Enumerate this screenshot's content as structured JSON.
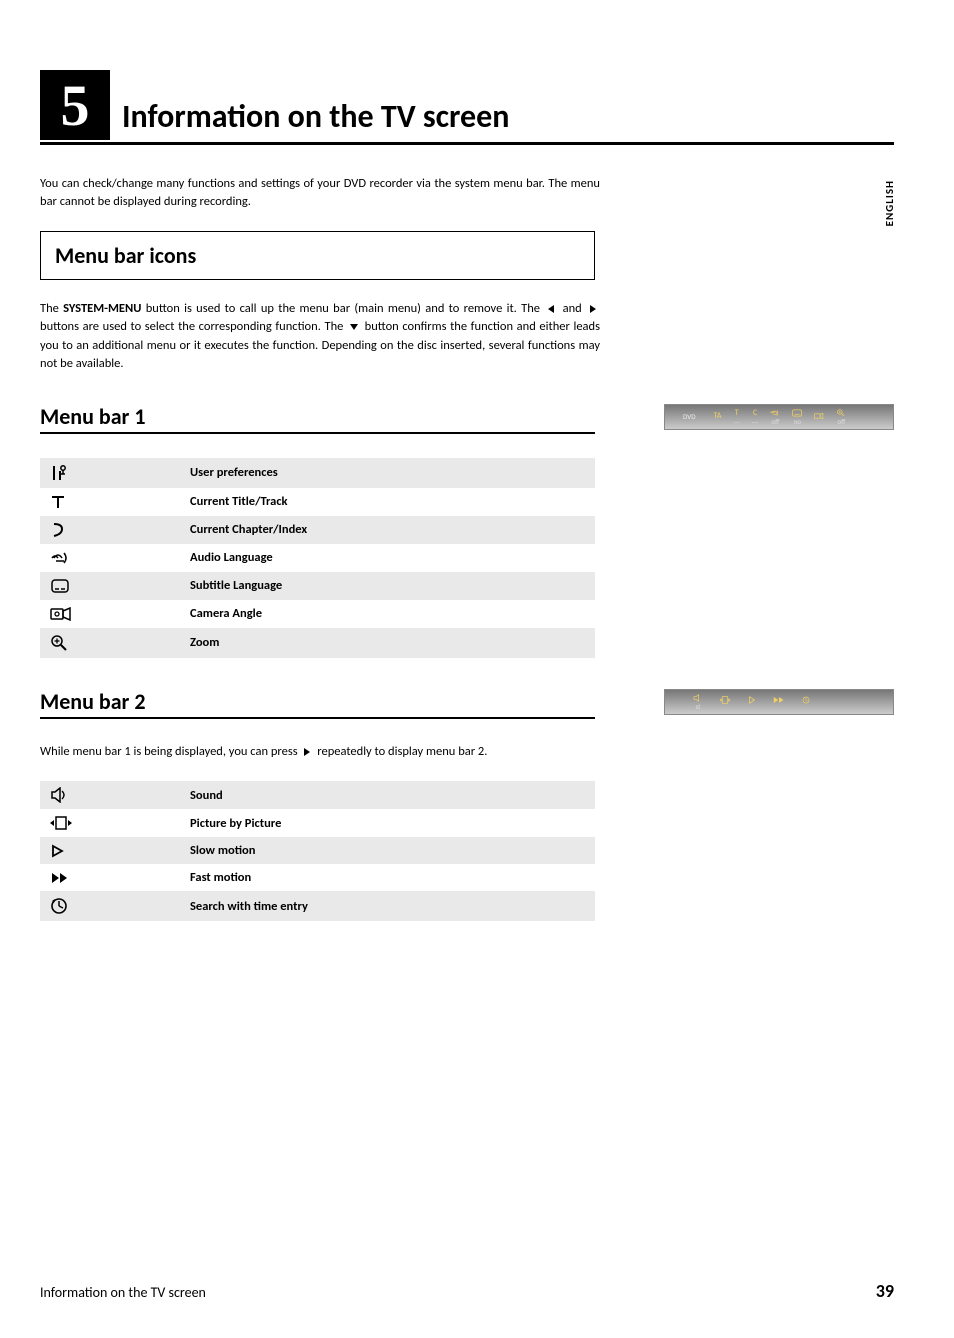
{
  "chapter": {
    "number": "5",
    "title": "Information on the TV screen"
  },
  "lang_tab": "ENGLISH",
  "intro": "You can check/change many functions and settings of your DVD recorder via the system menu bar. The menu bar cannot be displayed during recording.",
  "section1": {
    "heading": "Menu bar icons",
    "p_before": "The ",
    "p_system_menu": "SYSTEM-MENU",
    "p_after_sm": " button is used to call up the menu bar (main menu) and to remove it. The ",
    "p_mid1": " and ",
    "p_mid2": " buttons are used to select the corresponding function. The ",
    "p_after_down": " button confirms the function and either leads you to an additional menu or it executes the function. Depending on the disc inserted, several functions may not be available."
  },
  "menubar1": {
    "heading": "Menu bar 1",
    "rows": [
      {
        "icon": "prefs",
        "label": "User preferences"
      },
      {
        "icon": "title",
        "label": "Current Title/Track"
      },
      {
        "icon": "chapter",
        "label": "Current Chapter/Index"
      },
      {
        "icon": "audio",
        "label": "Audio Language"
      },
      {
        "icon": "subtitle",
        "label": "Subtitle Language"
      },
      {
        "icon": "camera",
        "label": "Camera Angle"
      },
      {
        "icon": "zoom",
        "label": "Zoom"
      }
    ],
    "osd": {
      "left_label": "DVD",
      "items": [
        {
          "top": "TA",
          "sub": ""
        },
        {
          "top": "T",
          "sub": "---"
        },
        {
          "top": "C",
          "sub": "---"
        },
        {
          "top": "audio",
          "sub": "off"
        },
        {
          "top": "sub",
          "sub": "no"
        },
        {
          "top": "cam",
          "sub": ""
        },
        {
          "top": "zoom",
          "sub": "off"
        }
      ]
    }
  },
  "menubar2": {
    "heading": "Menu bar 2",
    "intro_before": "While menu bar 1 is being displayed, you can press ",
    "intro_after": " repeatedly to display menu bar 2.",
    "rows": [
      {
        "icon": "sound",
        "label": "Sound"
      },
      {
        "icon": "pbp",
        "label": "Picture by Picture"
      },
      {
        "icon": "slow",
        "label": "Slow motion"
      },
      {
        "icon": "fast",
        "label": "Fast motion"
      },
      {
        "icon": "timesearch",
        "label": "Search with time entry"
      }
    ],
    "osd": {
      "sub": "st"
    }
  },
  "footer": {
    "title": "Information on the TV screen",
    "page": "39"
  }
}
